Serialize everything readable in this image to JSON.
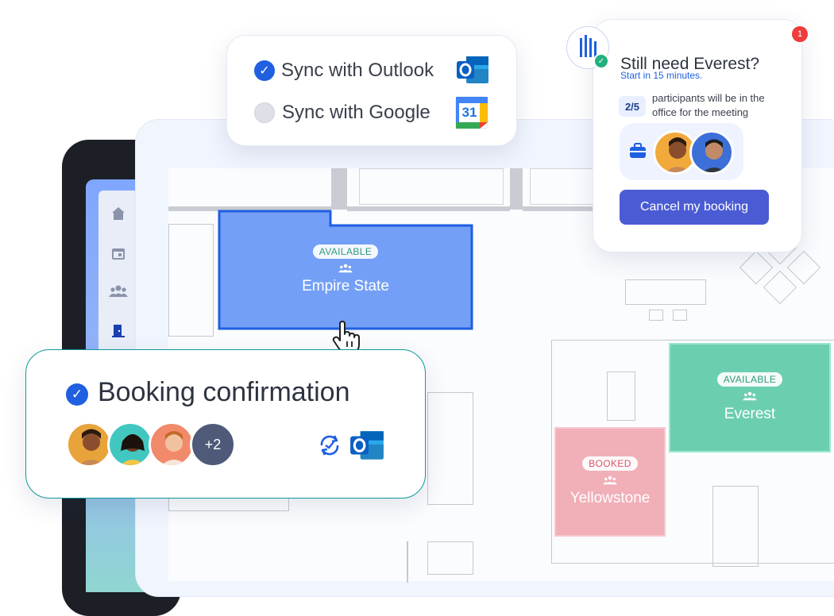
{
  "sync": {
    "outlook_label": "Sync with Outlook",
    "google_label": "Sync with Google",
    "google_calendar_day": "31"
  },
  "popup": {
    "title": "Still need Everest?",
    "subtitle": "Start in 15 minutes.",
    "participants_count": "2/5",
    "participants_text": "participants will be in the office for the meeting",
    "cancel_label": "Cancel my booking",
    "notification_count": "1"
  },
  "rooms": {
    "empire": {
      "status": "AVAILABLE",
      "name": "Empire State"
    },
    "everest": {
      "status": "AVAILABLE",
      "name": "Everest"
    },
    "yellowstone": {
      "status": "BOOKED",
      "name": "Yellowstone"
    }
  },
  "confirmation": {
    "title": "Booking confirmation",
    "extra_count": "+2"
  },
  "colors": {
    "accent_blue": "#1f5fe0",
    "room_available_blue": "#5b8ef5",
    "room_available_green": "#5cc9a7",
    "room_booked_pink": "#f0a8b2",
    "button_purple": "#4a5bd3"
  }
}
